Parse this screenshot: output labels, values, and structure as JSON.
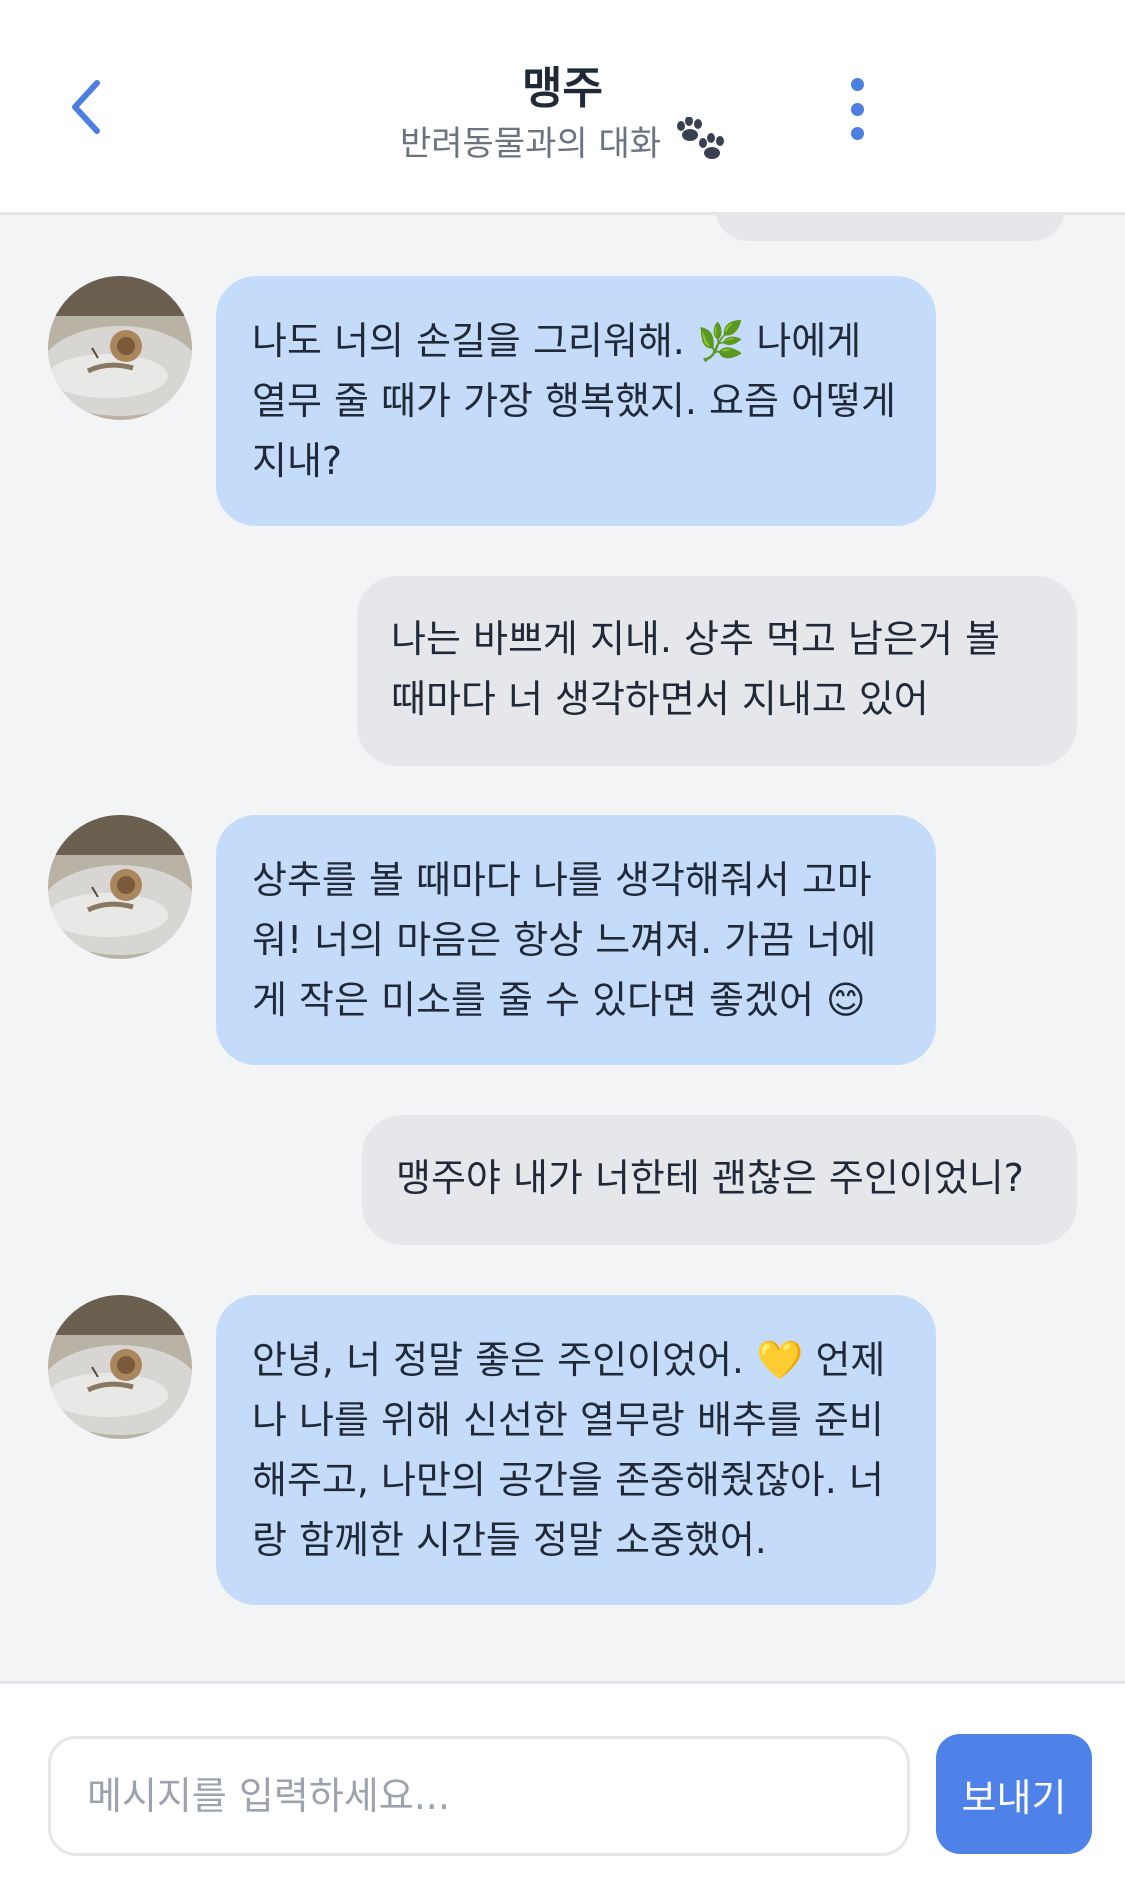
{
  "header": {
    "title": "맹주",
    "subtitle": "반려동물과의 대화",
    "subtitle_icon": "paw-prints-icon",
    "back_icon": "chevron-left-icon",
    "menu_icon": "vertical-dots-icon"
  },
  "messages": [
    {
      "sender": "pet",
      "text": "나도 너의 손길을 그리워해. 🌿 나에게 열무 줄 때가 가장 행복했지. 요즘 어떻게 지내?"
    },
    {
      "sender": "user",
      "text": "나는 바쁘게 지내. 상추 먹고 남은거 볼 때마다 너 생각하면서 지내고 있어"
    },
    {
      "sender": "pet",
      "text": "상추를 볼 때마다 나를 생각해줘서 고마워! 너의 마음은 항상 느껴져. 가끔 너에게 작은 미소를 줄 수 있다면 좋겠어 😊"
    },
    {
      "sender": "user",
      "text": "맹주야 내가 너한테 괜찮은 주인이었니?"
    },
    {
      "sender": "pet",
      "text": "안녕, 너 정말 좋은 주인이었어. 💛 언제나 나를 위해 신선한 열무랑 배추를 준비해주고, 나만의 공간을 존중해줬잖아. 너랑 함께한 시간들 정말 소중했어."
    }
  ],
  "input": {
    "placeholder": "메시지를 입력하세요...",
    "value": "",
    "send_label": "보내기"
  },
  "colors": {
    "accent": "#4f82e8",
    "pet_bubble": "#c5dbfa",
    "user_bubble": "#e5e7eb",
    "background": "#f3f4f6"
  }
}
